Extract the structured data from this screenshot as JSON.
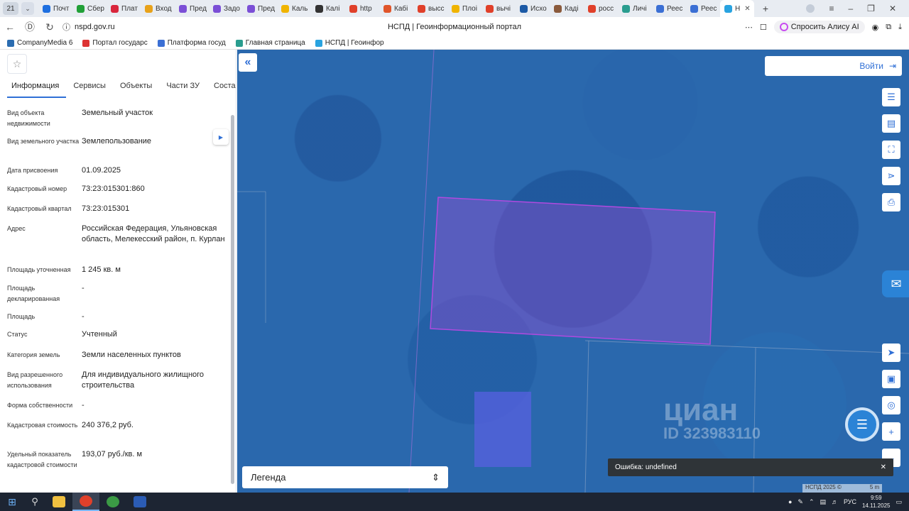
{
  "browser": {
    "tab_count": "21",
    "tabs": [
      {
        "label": "Почт",
        "color": "#1e6fe0"
      },
      {
        "label": "Сбер",
        "color": "#21a038"
      },
      {
        "label": "Плат",
        "color": "#d9263c"
      },
      {
        "label": "Вход",
        "color": "#e8a21a"
      },
      {
        "label": "Пред",
        "color": "#7b4fd6"
      },
      {
        "label": "Задо",
        "color": "#7b4fd6"
      },
      {
        "label": "Пред",
        "color": "#7b4fd6"
      },
      {
        "label": "Каль",
        "color": "#f0b400"
      },
      {
        "label": "Калі",
        "color": "#333333"
      },
      {
        "label": "http",
        "color": "#e0402a"
      },
      {
        "label": "Кабі",
        "color": "#e0552a"
      },
      {
        "label": "высс",
        "color": "#e0402a"
      },
      {
        "label": "Плоі",
        "color": "#f0b400"
      },
      {
        "label": "вычі",
        "color": "#e0402a"
      },
      {
        "label": "Исхо",
        "color": "#1c5aa6"
      },
      {
        "label": "Каді",
        "color": "#8a5a3c"
      },
      {
        "label": "росс",
        "color": "#e0402a"
      },
      {
        "label": "Личі",
        "color": "#2a9d8f"
      },
      {
        "label": "Реес",
        "color": "#3b6fd4"
      },
      {
        "label": "Реес",
        "color": "#3b6fd4"
      },
      {
        "label": "Н",
        "color": "#29a3e0"
      }
    ],
    "url": "nspd.gov.ru",
    "page_title": "НСПД | Геоинформационный портал",
    "alice_label": "Спросить Алису AI",
    "bookmarks": [
      {
        "label": "CompanyMedia 6",
        "color": "#2b6cb0"
      },
      {
        "label": "Портал государс",
        "color": "#d33"
      },
      {
        "label": "Платформа госуд",
        "color": "#3b6fd4"
      },
      {
        "label": "Главная страница",
        "color": "#2a9d8f"
      },
      {
        "label": "НСПД | Геоинфор",
        "color": "#29a3e0"
      }
    ]
  },
  "panel": {
    "tabs": [
      "Информация",
      "Сервисы",
      "Объекты",
      "Части ЗУ",
      "Соста"
    ],
    "fields": [
      {
        "label": "Вид объекта недвижимости",
        "value": "Земельный участок"
      },
      {
        "label": "Вид земельного участка",
        "value": "Землепользование"
      },
      {
        "label": "Дата присвоения",
        "value": "01.09.2025"
      },
      {
        "label": "Кадастровый номер",
        "value": "73:23:015301:860"
      },
      {
        "label": "Кадастровый квартал",
        "value": "73:23:015301"
      },
      {
        "label": "Адрес",
        "value": "Российская Федерация, Ульяновская область, Мелекесский район, п. Курлан"
      },
      {
        "label": "Площадь уточненная",
        "value": "1 245 кв. м"
      },
      {
        "label": "Площадь декларированная",
        "value": "-"
      },
      {
        "label": "Площадь",
        "value": "-"
      },
      {
        "label": "Статус",
        "value": "Учтенный"
      },
      {
        "label": "Категория земель",
        "value": "Земли населенных пунктов"
      },
      {
        "label": "Вид разрешенного использования",
        "value": "Для индивидуального жилищного строительства"
      },
      {
        "label": "Форма собственности",
        "value": "-"
      },
      {
        "label": "Кадастровая стоимость",
        "value": "240 376,2 руб."
      },
      {
        "label": "Удельный показатель кадастровой стоимости",
        "value": "193,07 руб./кв. м"
      }
    ]
  },
  "map": {
    "login_label": "Войти",
    "legend_label": "Легенда",
    "error_text": "Ошибка: undefined",
    "watermark_brand": "циан",
    "watermark_id": "ID 323983110",
    "copyright": "НСПД 2025 ©",
    "scale": "5 m",
    "parcel_color": "#b04adf"
  },
  "taskbar": {
    "lang": "РУС",
    "time": "9:59",
    "date": "14.11.2025"
  }
}
